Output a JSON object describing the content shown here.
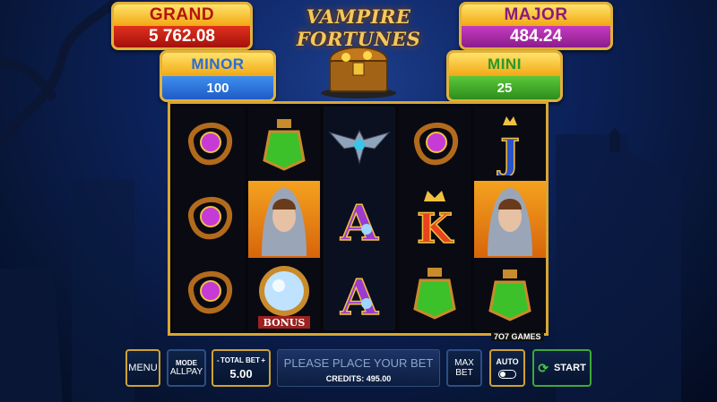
{
  "jackpots": {
    "grand": {
      "label": "GRAND",
      "value": "5 762.08"
    },
    "major": {
      "label": "MAJOR",
      "value": "484.24"
    },
    "minor": {
      "label": "MINOR",
      "value": "100"
    },
    "mini": {
      "label": "MINI",
      "value": "25"
    }
  },
  "logo": "VAMPIRE FORTUNES",
  "reels": [
    [
      "amulet",
      "amulet",
      "amulet"
    ],
    [
      "green-potion",
      "vampire-lady",
      "bonus-orb"
    ],
    [
      "bat-crest",
      "letter-a",
      "letter-a"
    ],
    [
      "amulet",
      "letter-k",
      "green-potion"
    ],
    [
      "letter-j",
      "vampire-lady",
      "green-potion"
    ]
  ],
  "bonus_label": "BONUS",
  "brand": "7O7 GAMES",
  "controls": {
    "menu": "MENU",
    "mode_label": "MODE",
    "mode_value": "ALLPAY",
    "total_bet_label": "TOTAL BET",
    "total_bet_minus": "-",
    "total_bet_plus": "+",
    "total_bet_value": "5.00",
    "message": "PLEASE PLACE YOUR BET",
    "credits": "CREDITS: 495.00",
    "max_bet_1": "MAX",
    "max_bet_2": "BET",
    "auto": "AUTO",
    "start": "START"
  },
  "colors": {
    "gold": "#d8a631",
    "grand": "#c41d11",
    "major": "#a82ba6",
    "minor": "#2f7be0",
    "mini": "#3fa52a"
  }
}
